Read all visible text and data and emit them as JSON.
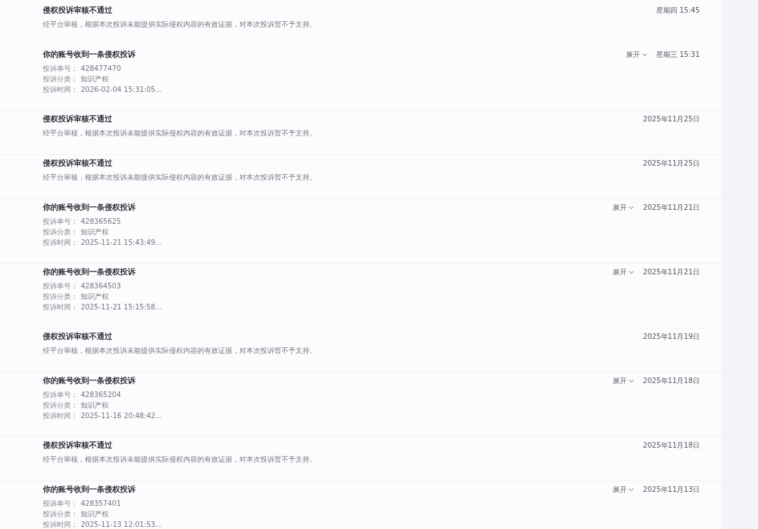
{
  "notifications": [
    {
      "kind": "rejected",
      "title": "侵权投诉审核不通过",
      "body": "经平台审核，根据本次投诉未能提供实际侵权内容的有效证据，对本次投诉暂不予支持。",
      "time": "星期四 15:45"
    },
    {
      "kind": "complaint",
      "title": "你的账号收到一条侵权投诉",
      "fields": [
        {
          "label": "投诉单号：",
          "value": "428477470"
        },
        {
          "label": "投诉分类：",
          "value": "知识产权"
        },
        {
          "label": "投诉时间：",
          "value": "2026-02-04 15:31:05..."
        }
      ],
      "toggle": "展开",
      "expanded": false,
      "time": "星期三 15:31"
    },
    {
      "kind": "rejected",
      "title": "侵权投诉审核不通过",
      "body": "经平台审核，根据本次投诉未能提供实际侵权内容的有效证据，对本次投诉暂不予支持。",
      "time": "2025年11月25日"
    },
    {
      "kind": "rejected",
      "title": "侵权投诉审核不通过",
      "body": "经平台审核，根据本次投诉未能提供实际侵权内容的有效证据，对本次投诉暂不予支持。",
      "time": "2025年11月25日"
    },
    {
      "kind": "complaint",
      "title": "你的账号收到一条侵权投诉",
      "fields": [
        {
          "label": "投诉单号：",
          "value": "428365625"
        },
        {
          "label": "投诉分类：",
          "value": "知识产权"
        },
        {
          "label": "投诉时间：",
          "value": "2025-11-21 15:43:49..."
        }
      ],
      "toggle": "展开",
      "expanded": false,
      "time": "2025年11月21日"
    },
    {
      "kind": "complaint",
      "title": "你的账号收到一条侵权投诉",
      "fields": [
        {
          "label": "投诉单号：",
          "value": "428364503"
        },
        {
          "label": "投诉分类：",
          "value": "知识产权"
        },
        {
          "label": "投诉时间：",
          "value": "2025-11-21 15:15:58..."
        }
      ],
      "toggle": "展开",
      "expanded": false,
      "time": "2025年11月21日"
    },
    {
      "kind": "rejected",
      "title": "侵权投诉审核不通过",
      "body": "经平台审核，根据本次投诉未能提供实际侵权内容的有效证据，对本次投诉暂不予支持。",
      "time": "2025年11月19日"
    },
    {
      "kind": "complaint",
      "title": "你的账号收到一条侵权投诉",
      "fields": [
        {
          "label": "投诉单号：",
          "value": "428365204"
        },
        {
          "label": "投诉分类：",
          "value": "知识产权"
        },
        {
          "label": "投诉时间：",
          "value": "2025-11-16 20:48:42..."
        }
      ],
      "toggle": "展开",
      "expanded": false,
      "time": "2025年11月18日"
    },
    {
      "kind": "rejected",
      "title": "侵权投诉审核不通过",
      "body": "经平台审核，根据本次投诉未能提供实际侵权内容的有效证据，对本次投诉暂不予支持。",
      "time": "2025年11月18日"
    },
    {
      "kind": "complaint",
      "title": "你的账号收到一条侵权投诉",
      "fields": [
        {
          "label": "投诉单号：",
          "value": "428357401"
        },
        {
          "label": "投诉分类：",
          "value": "知识产权"
        },
        {
          "label": "投诉时间：",
          "value": "2025-11-13 12:01:53..."
        }
      ],
      "toggle": "展开",
      "expanded": false,
      "time": "2025年11月13日"
    }
  ]
}
